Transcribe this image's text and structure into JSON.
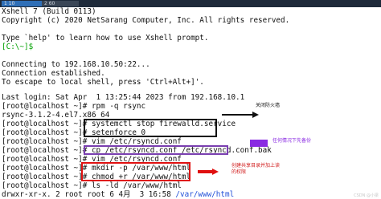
{
  "tabs": [
    {
      "label": "1 10"
    },
    {
      "label": "2 60"
    }
  ],
  "terminal": {
    "lines": [
      {
        "text": "Xshell 7 (Build 0113)"
      },
      {
        "text": "Copyright (c) 2020 NetSarang Computer, Inc. All rights reserved."
      },
      {
        "text": ""
      },
      {
        "text": "Type `help' to learn how to use Xshell prompt."
      },
      {
        "text": "[C:\\~]$"
      },
      {
        "text": ""
      },
      {
        "text": "Connecting to 192.168.10.50:22..."
      },
      {
        "text": "Connection established."
      },
      {
        "text": "To escape to local shell, press 'Ctrl+Alt+]'."
      },
      {
        "text": ""
      },
      {
        "text": "Last login: Sat Apr  1 13:25:44 2023 from 192.168.10.1"
      },
      {
        "text": "[root@localhost ~]# rpm -q rsync"
      },
      {
        "text": "rsync-3.1.2-4.el7.x86_64"
      },
      {
        "text": "[root@localhost ~]# systemctl stop firewalld.service"
      },
      {
        "text": "[root@localhost ~]# setenforce 0"
      },
      {
        "text": "[root@localhost ~]# vim /etc/rsyncd.conf"
      },
      {
        "text": "[root@localhost ~]# cp /etc/rsyncd.conf /etc/rsyncd.conf.bak"
      },
      {
        "text": "[root@localhost ~]# vim /etc/rsyncd.conf"
      },
      {
        "text": "[root@localhost ~]# mkdir -p /var/www/html"
      },
      {
        "text": "[root@localhost ~]# chmod +r /var/www/html"
      },
      {
        "text": "[root@localhost ~]# ls -ld /var/www/html"
      },
      {
        "text": "drwxr-xr-x. 2 root root 6 4月  3 16:58 "
      },
      {
        "text": "/var/www/html"
      }
    ],
    "local_prompt_color": "#00a000",
    "dir_color": "#1f4fd8"
  },
  "annotations": [
    {
      "text": "关闭防火墙",
      "color": "#111111"
    },
    {
      "text": "任何情况下先备份",
      "color": "#8a2be2"
    },
    {
      "text": "创建共享目录并加上读\n的权限",
      "color": "#d22020"
    }
  ],
  "highlight_colors": {
    "black": "#111111",
    "purple": "#7a3fb0",
    "red": "#e01010"
  },
  "watermark": "CSDN @小梁"
}
